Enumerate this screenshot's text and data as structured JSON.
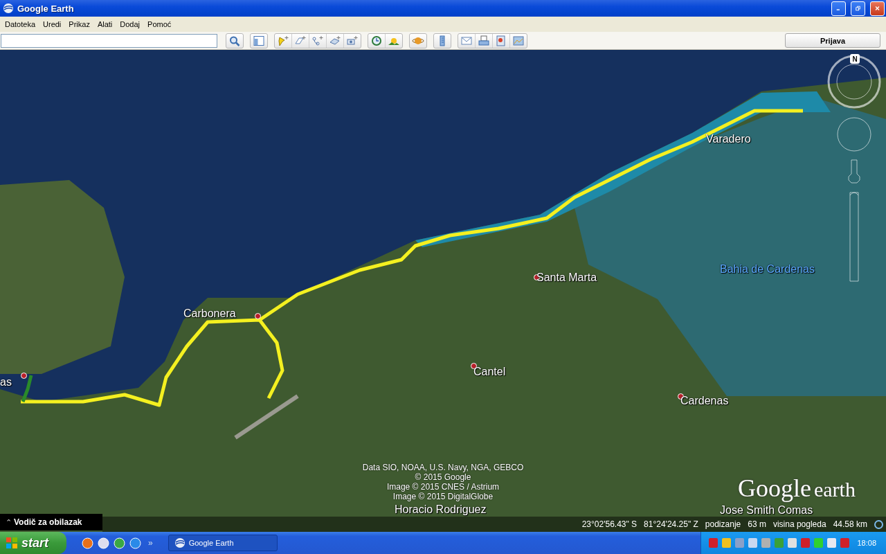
{
  "window": {
    "title": "Google Earth"
  },
  "menu": [
    "Datoteka",
    "Uredi",
    "Prikaz",
    "Alati",
    "Dodaj",
    "Pomoć"
  ],
  "toolbar": {
    "sign_in_button": "Prijava"
  },
  "map": {
    "places": [
      {
        "name": "as",
        "kind": "town"
      },
      {
        "name": "Carbonera",
        "kind": "town"
      },
      {
        "name": "Varadero",
        "kind": "plain"
      },
      {
        "name": "Santa Marta",
        "kind": "town"
      },
      {
        "name": "Bahia de Cardenas",
        "kind": "water"
      },
      {
        "name": "Cantel",
        "kind": "town"
      },
      {
        "name": "Cardenas",
        "kind": "town"
      },
      {
        "name": "Horacio Rodriguez",
        "kind": "plain"
      },
      {
        "name": "Jose Smith Comas",
        "kind": "plain"
      }
    ],
    "attribution": [
      "Data SIO, NOAA, U.S. Navy, NGA, GEBCO",
      "© 2015 Google",
      "Image © 2015 CNES / Astrium",
      "Image © 2015 DigitalGlobe"
    ],
    "logo": {
      "brand": "Google",
      "product": "earth"
    },
    "compass": "N",
    "tour_guide": {
      "label": "Vodič za obilazak",
      "icon": "⌃"
    },
    "status": {
      "latitude": "23°02'56.43\" S",
      "longitude": "81°24'24.25\" Z",
      "elevation_label": "podizanje",
      "elevation": "63 m",
      "eye_alt_label": "visina pogleda",
      "eye_alt": "44.58 km"
    }
  },
  "taskbar": {
    "start": "start",
    "more": "»",
    "tasks": [
      {
        "label": "Google Earth",
        "selected": false
      }
    ],
    "clock": "18:08"
  }
}
